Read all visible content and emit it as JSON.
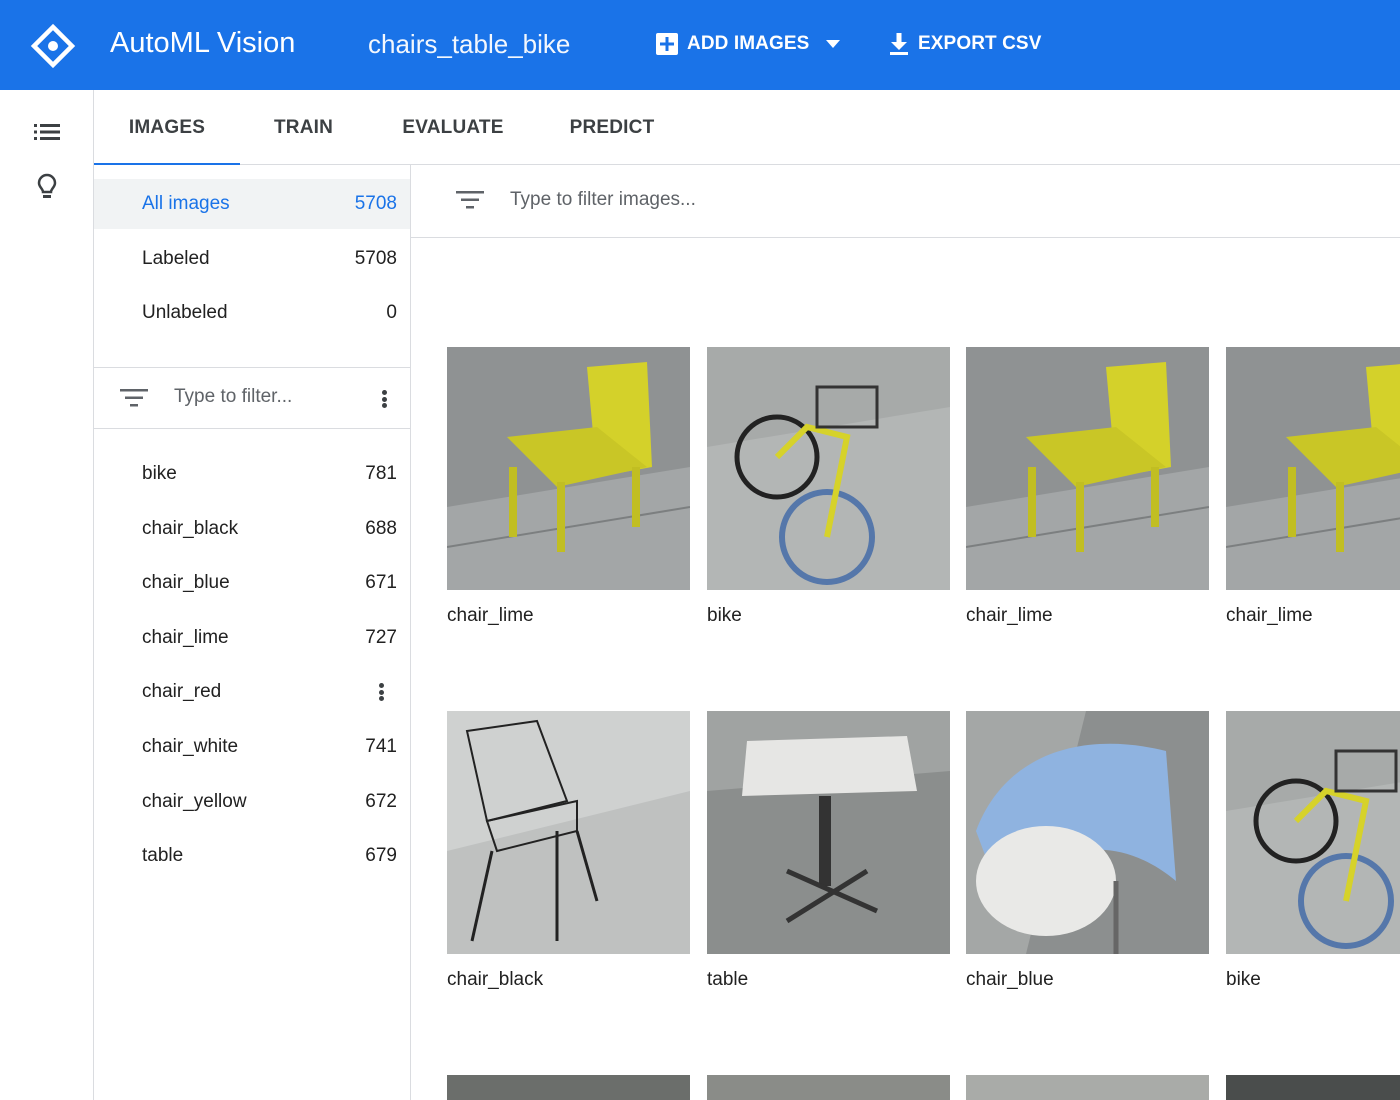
{
  "appbar": {
    "title": "AutoML Vision",
    "dataset": "chairs_table_bike",
    "add_images_label": "ADD IMAGES",
    "export_csv_label": "EXPORT CSV",
    "color": "#1a73e8"
  },
  "rail": {
    "icons": [
      "list-icon",
      "lightbulb-icon"
    ]
  },
  "tabs": [
    {
      "label": "IMAGES",
      "active": true
    },
    {
      "label": "TRAIN",
      "active": false
    },
    {
      "label": "EVALUATE",
      "active": false
    },
    {
      "label": "PREDICT",
      "active": false
    }
  ],
  "sidebar": {
    "summary": [
      {
        "label": "All images",
        "count": "5708",
        "selected": true
      },
      {
        "label": "Labeled",
        "count": "5708"
      },
      {
        "label": "Unlabeled",
        "count": "0"
      }
    ],
    "label_filter_placeholder": "Type to filter...",
    "labels": [
      {
        "label": "bike",
        "count": "781"
      },
      {
        "label": "chair_black",
        "count": "688"
      },
      {
        "label": "chair_blue",
        "count": "671"
      },
      {
        "label": "chair_lime",
        "count": "727"
      },
      {
        "label": "chair_red",
        "count": ""
      },
      {
        "label": "chair_white",
        "count": "741"
      },
      {
        "label": "chair_yellow",
        "count": "672"
      },
      {
        "label": "table",
        "count": "679"
      }
    ]
  },
  "main": {
    "filter_placeholder": "Type to filter images...",
    "images": [
      {
        "caption": "chair_lime",
        "kind": "chair_lime"
      },
      {
        "caption": "bike",
        "kind": "bike"
      },
      {
        "caption": "chair_lime",
        "kind": "chair_lime"
      },
      {
        "caption": "chair_lime",
        "kind": "chair_lime"
      },
      {
        "caption": "chair_black",
        "kind": "chair_black"
      },
      {
        "caption": "table",
        "kind": "table"
      },
      {
        "caption": "chair_blue",
        "kind": "chair_blue"
      },
      {
        "caption": "bike",
        "kind": "bike"
      }
    ]
  }
}
